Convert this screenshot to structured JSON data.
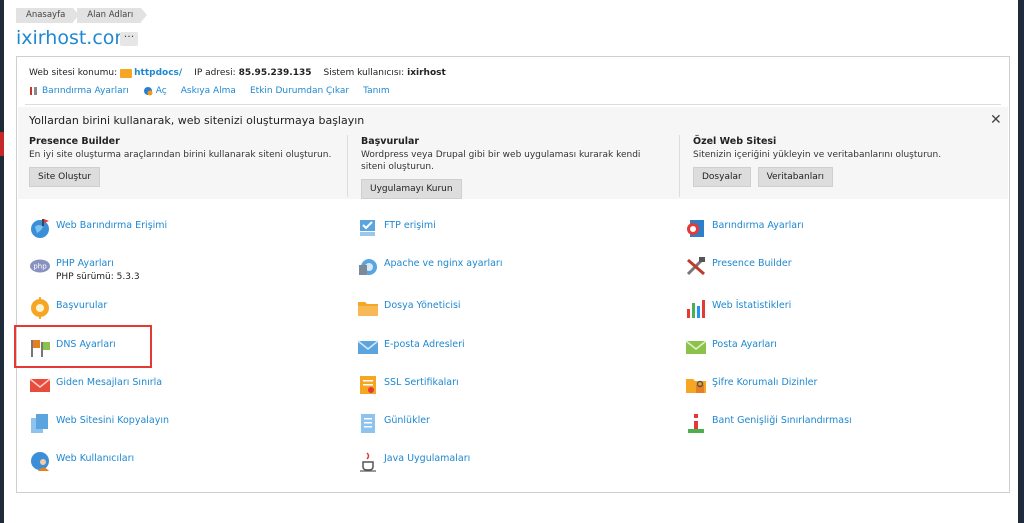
{
  "breadcrumb": [
    "Anasayfa",
    "Alan Adları"
  ],
  "title": "ixirhost.com",
  "more_label": "···",
  "info": {
    "location_label": "Web sitesi konumu:",
    "location_value": "httpdocs/",
    "ip_label": "IP adresi:",
    "ip_value": "85.95.239.135",
    "user_label": "Sistem kullanıcısı:",
    "user_value": "ixirhost"
  },
  "links": [
    "Barındırma Ayarları",
    "Aç",
    "Askıya Alma",
    "Etkin Durumdan Çıkar",
    "Tanım"
  ],
  "promo": {
    "title": "Yollardan birini kullanarak, web sitenizi oluşturmaya başlayın",
    "close": "✕",
    "columns": [
      {
        "heading": "Presence Builder",
        "desc": "En iyi site oluşturma araçlarından birini kullanarak siteni oluşturun.",
        "buttons": [
          "Site Oluştur"
        ]
      },
      {
        "heading": "Başvurular",
        "desc": "Wordpress veya Drupal gibi bir web uygulaması kurarak kendi siteni oluşturun.",
        "buttons": [
          "Uygulamayı Kurun"
        ]
      },
      {
        "heading": "Özel Web Sitesi",
        "desc": "Sitenizin içeriğini yükleyin ve veritabanlarını oluşturun.",
        "buttons": [
          "Dosyalar",
          "Veritabanları"
        ]
      }
    ]
  },
  "tools": [
    {
      "label": "Web Barındırma Erişimi",
      "icon": "globe-icon"
    },
    {
      "label": "FTP erişimi",
      "icon": "ftp-icon"
    },
    {
      "label": "Barındırma Ayarları",
      "icon": "hosting-settings-icon"
    },
    {
      "label": "PHP Ayarları",
      "sub": "PHP sürümü: 5.3.3",
      "icon": "php-icon"
    },
    {
      "label": "Apache ve nginx ayarları",
      "icon": "apache-icon"
    },
    {
      "label": "Presence Builder",
      "icon": "tools-icon"
    },
    {
      "label": "Başvurular",
      "icon": "gear-icon"
    },
    {
      "label": "Dosya Yöneticisi",
      "icon": "folder-icon"
    },
    {
      "label": "Web İstatistikleri",
      "icon": "chart-icon"
    },
    {
      "label": "DNS Ayarları",
      "icon": "dns-flags-icon"
    },
    {
      "label": "E-posta Adresleri",
      "icon": "envelope-icon"
    },
    {
      "label": "Posta Ayarları",
      "icon": "mail-settings-icon"
    },
    {
      "label": "Giden Mesajları Sınırla",
      "icon": "envelope-limit-icon"
    },
    {
      "label": "SSL Sertifikaları",
      "icon": "certificate-icon"
    },
    {
      "label": "Şifre Korumalı Dizinler",
      "icon": "locked-folder-icon"
    },
    {
      "label": "Web Sitesini Kopyalayın",
      "icon": "copy-icon"
    },
    {
      "label": "Günlükler",
      "icon": "logs-icon"
    },
    {
      "label": "Bant Genişliği Sınırlandırması",
      "icon": "bandwidth-icon"
    },
    {
      "label": "Web Kullanıcıları",
      "icon": "web-users-icon"
    },
    {
      "label": "Java Uygulamaları",
      "icon": "java-icon"
    }
  ]
}
